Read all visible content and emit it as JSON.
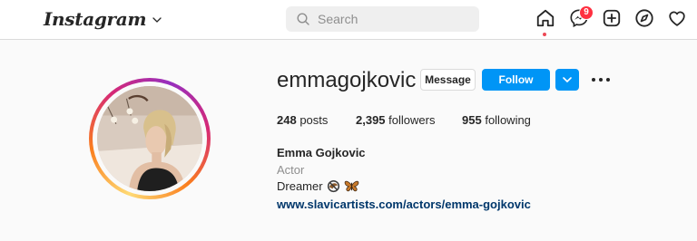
{
  "header": {
    "logo_text": "Instagram",
    "search": {
      "placeholder": "Search",
      "value": ""
    },
    "notifications": {
      "messages_badge": "9"
    },
    "colors": {
      "badge": "#ff3040",
      "active_dot": "#ed4956"
    },
    "icons": [
      "chevron-down-icon",
      "search-icon",
      "home-icon",
      "messenger-icon",
      "new-post-icon",
      "explore-icon",
      "heart-icon"
    ]
  },
  "profile": {
    "username": "emmagojkovic",
    "buttons": {
      "message": "Message",
      "follow": "Follow"
    },
    "stats": {
      "posts": {
        "count": "248",
        "label": "posts"
      },
      "followers": {
        "count": "2,395",
        "label": "followers"
      },
      "following": {
        "count": "955",
        "label": "following"
      }
    },
    "full_name": "Emma Gojkovic",
    "category": "Actor",
    "bio_text": "Dreamer",
    "bio_emoji_icons": [
      "no-sign-icon",
      "butterfly-icon"
    ],
    "website": "www.slavicartists.com/actors/emma-gojkovic",
    "colors": {
      "follow_button": "#0095f6",
      "link": "#00376b",
      "story_ring": [
        "#feda75",
        "#fa7e1e",
        "#d62976",
        "#962fbf"
      ]
    }
  }
}
